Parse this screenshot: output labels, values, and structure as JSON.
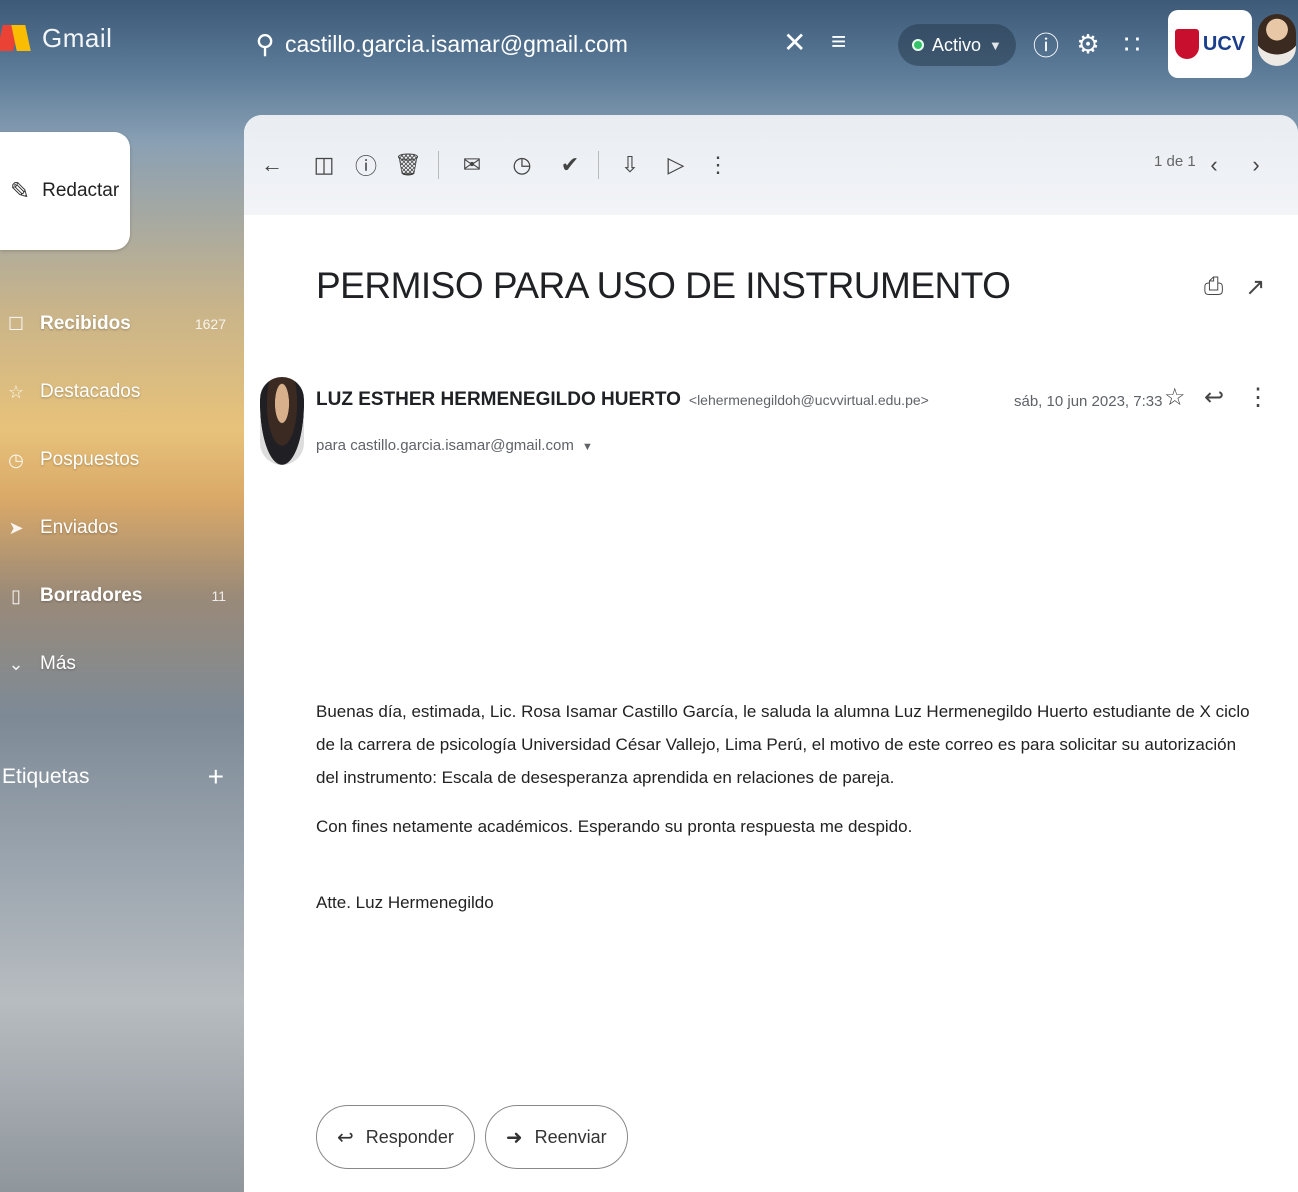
{
  "app": {
    "name": "Gmail"
  },
  "search": {
    "value": "castillo.garcia.isamar@gmail.com",
    "placeholder": ""
  },
  "status": {
    "label": "Activo"
  },
  "brand": {
    "badge_text": "UCV"
  },
  "sidebar": {
    "compose_label": "Redactar",
    "items": [
      {
        "label": "Recibidos",
        "count": "1627",
        "icon": "inbox-icon"
      },
      {
        "label": "Destacados",
        "count": "",
        "icon": "star-icon"
      },
      {
        "label": "Pospuestos",
        "count": "",
        "icon": "clock-icon"
      },
      {
        "label": "Enviados",
        "count": "",
        "icon": "send-icon"
      },
      {
        "label": "Borradores",
        "count": "11",
        "icon": "draft-icon"
      },
      {
        "label": "Más",
        "count": "",
        "icon": "chevron-down-icon"
      }
    ],
    "labels_title": "Etiquetas"
  },
  "toolbar": {
    "pager": "1 de 1"
  },
  "message": {
    "subject": "PERMISO PARA USO DE INSTRUMENTO",
    "sender_name": "LUZ ESTHER HERMENEGILDO HUERTO",
    "sender_email": "<lehermenegildoh@ucvvirtual.edu.pe>",
    "recipient": "para castillo.garcia.isamar@gmail.com",
    "date": "sáb, 10 jun 2023, 7:33",
    "body": [
      "Buenas día, estimada, Lic. Rosa Isamar Castillo García, le saluda la alumna Luz Hermenegildo Huerto estudiante de X ciclo de la carrera de psicología Universidad César Vallejo, Lima Perú, el motivo de este correo es para solicitar su autorización del instrumento: Escala de desesperanza aprendida en relaciones de pareja.",
      "Con fines netamente académicos. Esperando su pronta respuesta me despido.",
      "Atte. Luz Hermenegildo"
    ]
  },
  "actions": {
    "reply_label": "Responder",
    "forward_label": "Reenviar"
  },
  "colors": {
    "status_dot": "#34c36a",
    "brand_red": "#c8102e",
    "brand_blue": "#1a3d8c"
  }
}
